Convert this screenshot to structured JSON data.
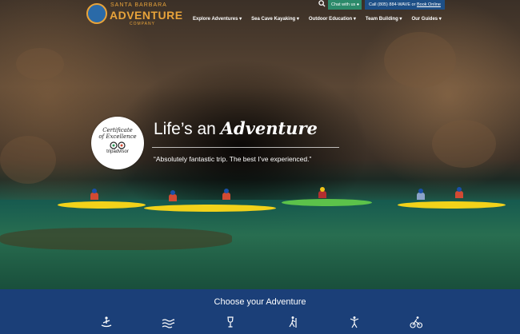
{
  "brand": {
    "small": "SANTA BARBARA",
    "big": "ADVENTURE",
    "sub": "COMPANY"
  },
  "topbar": {
    "chat_label": "Chat with us",
    "phone_text": "Call (805) 884-WAVE or ",
    "book_label": "Book Online"
  },
  "nav": {
    "items": [
      {
        "label": "Explore Adventures ▾"
      },
      {
        "label": "Sea Cave Kayaking ▾"
      },
      {
        "label": "Outdoor Education ▾"
      },
      {
        "label": "Team Building ▾"
      },
      {
        "label": "Our Guides ▾"
      }
    ]
  },
  "badge": {
    "line1": "Certificate",
    "line2": "of Excellence",
    "brand": "tripadvisor"
  },
  "hero": {
    "headline_prefix": "Life’s an ",
    "headline_script": "Adventure",
    "quote": "“Absolutely fantastic trip. The best I’ve experienced.”"
  },
  "bottom": {
    "title": "Choose your Adventure",
    "icons": [
      "kayak-icon",
      "waves-icon",
      "wine-glass-icon",
      "hiking-icon",
      "yoga-icon",
      "cycling-icon"
    ]
  },
  "colors": {
    "accent": "#e8a33a",
    "nav_blue": "#1d4f86",
    "chat_green": "#2c8a6a",
    "bottom_blue": "#1b3f78"
  }
}
